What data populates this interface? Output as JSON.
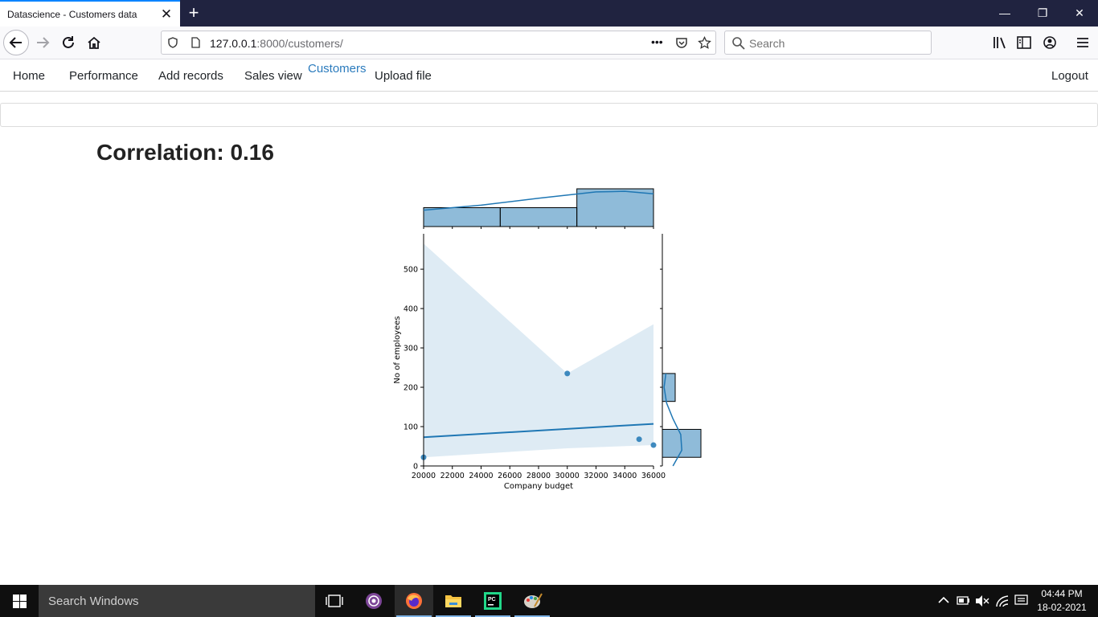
{
  "browser": {
    "tab_title": "Datascience - Customers data",
    "tab_close": "✕",
    "new_tab": "+",
    "url_host": "127.0.0.1",
    "url_path": ":8000/customers/",
    "page_actions": "•••",
    "search_placeholder": "Search",
    "window_min": "—",
    "window_max": "❐",
    "window_close": "✕"
  },
  "site_nav": {
    "items": [
      "Home",
      "Performance",
      "Add records",
      "Sales view",
      "Customers",
      "Upload file"
    ],
    "active": "Customers",
    "logout": "Logout"
  },
  "page": {
    "correlation_text": "Correlation: 0.16"
  },
  "chart_data": {
    "type": "scatter",
    "subtype": "jointplot with regression line, confidence band, marginal histograms and KDE",
    "xlabel": "Company budget",
    "ylabel": "No of employees",
    "xlim": [
      20000,
      36000
    ],
    "ylim": [
      0,
      590
    ],
    "x_ticks": [
      20000,
      22000,
      24000,
      26000,
      28000,
      30000,
      32000,
      34000,
      36000
    ],
    "y_ticks": [
      0,
      100,
      200,
      300,
      400,
      500
    ],
    "points": [
      {
        "x": 20000,
        "y": 22
      },
      {
        "x": 30000,
        "y": 235
      },
      {
        "x": 35000,
        "y": 68
      },
      {
        "x": 36000,
        "y": 53
      }
    ],
    "regression_line": {
      "x": [
        20000,
        36000
      ],
      "y": [
        73,
        107
      ]
    },
    "confidence_band": {
      "x": [
        20000,
        30000,
        36000
      ],
      "upper": [
        565,
        235,
        360
      ],
      "lower": [
        22,
        45,
        53
      ]
    },
    "x_histogram": {
      "bin_edges": [
        20000,
        25333,
        30667,
        36000
      ],
      "counts": [
        1,
        1,
        2
      ],
      "kde": {
        "x": [
          20000,
          24000,
          28000,
          32000,
          34000,
          36000
        ],
        "density": [
          0.26,
          0.34,
          0.45,
          0.55,
          0.56,
          0.52
        ]
      }
    },
    "y_histogram": {
      "bin_edges": [
        22,
        93,
        164,
        235
      ],
      "counts": [
        3,
        0,
        1
      ],
      "kde": {
        "y": [
          0,
          40,
          80,
          120,
          160,
          200,
          235
        ],
        "density": [
          0.3,
          0.55,
          0.52,
          0.3,
          0.12,
          0.05,
          0.1
        ]
      }
    },
    "color": "#1f77b4"
  },
  "taskbar": {
    "search_text": "Search Windows",
    "time": "04:44 PM",
    "date": "18-02-2021"
  }
}
